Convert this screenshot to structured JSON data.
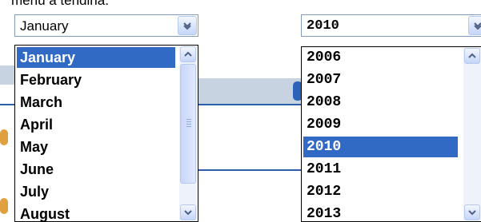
{
  "caption": "menù a tendina.",
  "month_picker": {
    "selected": "January",
    "options": [
      "January",
      "February",
      "March",
      "April",
      "May",
      "June",
      "July",
      "August"
    ],
    "highlighted_index": 0
  },
  "year_picker": {
    "selected": "2010",
    "options": [
      "2006",
      "2007",
      "2008",
      "2009",
      "2010",
      "2011",
      "2012",
      "2013"
    ],
    "highlighted_index": 4
  },
  "icons": {
    "dropdown": "chevron-down-icon",
    "scroll_up": "chevron-up-icon",
    "scroll_down": "chevron-down-icon"
  },
  "colors": {
    "selection": "#316ac5",
    "combo_border": "#7f9db9",
    "scroll_button": "#c5d5fa",
    "arrow": "#4d6185"
  }
}
